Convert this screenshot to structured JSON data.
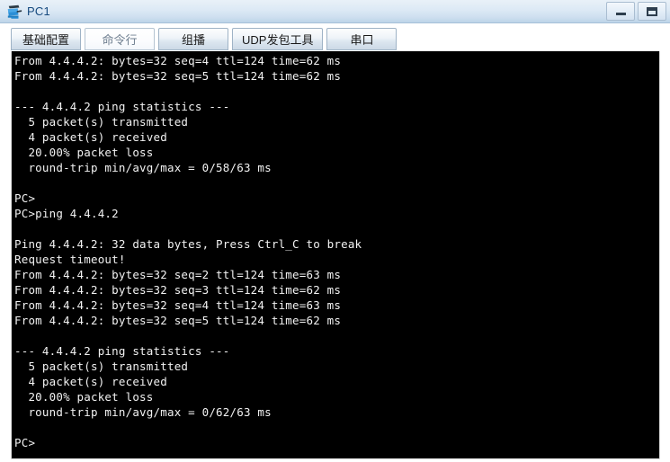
{
  "window": {
    "title": "PC1",
    "icon": "pc-terminal-icon",
    "controls": [
      {
        "name": "minimize-button",
        "glyph": "minimize-icon"
      },
      {
        "name": "maximize-button",
        "glyph": "maximize-icon"
      }
    ]
  },
  "tabs": [
    {
      "label": "基础配置",
      "active": false
    },
    {
      "label": "命令行",
      "active": true
    },
    {
      "label": "组播",
      "active": false
    },
    {
      "label": "UDP发包工具",
      "active": false
    },
    {
      "label": "串口",
      "active": false
    }
  ],
  "terminal": {
    "background": "#000000",
    "foreground": "#f2f2f2",
    "prompt": "PC>",
    "lines": [
      "From 4.4.4.2: bytes=32 seq=4 ttl=124 time=62 ms",
      "From 4.4.4.2: bytes=32 seq=5 ttl=124 time=62 ms",
      "",
      "--- 4.4.4.2 ping statistics ---",
      "  5 packet(s) transmitted",
      "  4 packet(s) received",
      "  20.00% packet loss",
      "  round-trip min/avg/max = 0/58/63 ms",
      "",
      "PC>",
      "PC>ping 4.4.4.2",
      "",
      "Ping 4.4.4.2: 32 data bytes, Press Ctrl_C to break",
      "Request timeout!",
      "From 4.4.4.2: bytes=32 seq=2 ttl=124 time=63 ms",
      "From 4.4.4.2: bytes=32 seq=3 ttl=124 time=62 ms",
      "From 4.4.4.2: bytes=32 seq=4 ttl=124 time=63 ms",
      "From 4.4.4.2: bytes=32 seq=5 ttl=124 time=62 ms",
      "",
      "--- 4.4.4.2 ping statistics ---",
      "  5 packet(s) transmitted",
      "  4 packet(s) received",
      "  20.00% packet loss",
      "  round-trip min/avg/max = 0/62/63 ms",
      "",
      "PC>"
    ]
  }
}
